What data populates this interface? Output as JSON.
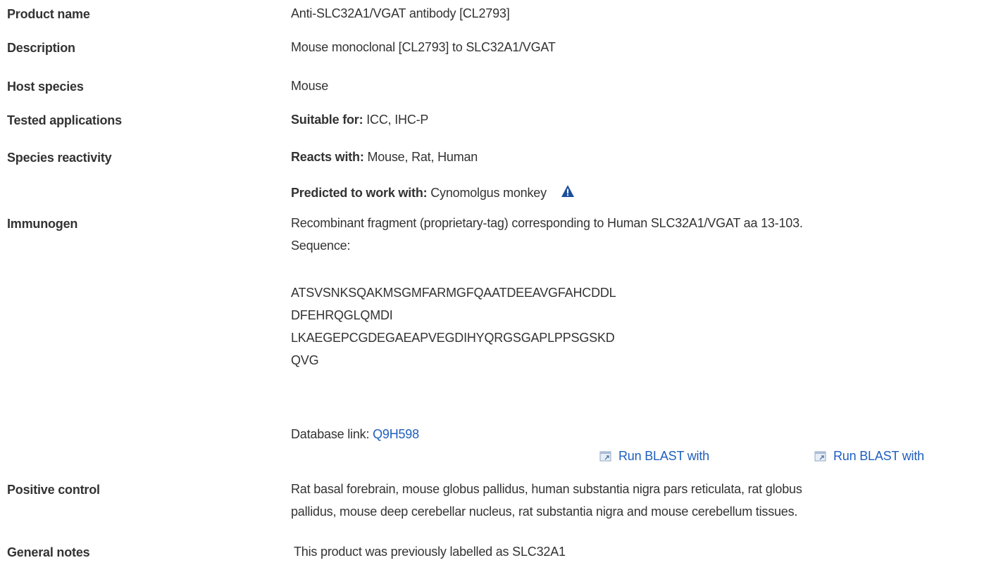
{
  "rows": {
    "product_name": {
      "label": "Product name",
      "value": "Anti-SLC32A1/VGAT antibody [CL2793]"
    },
    "description": {
      "label": "Description",
      "value": "Mouse monoclonal [CL2793] to SLC32A1/VGAT"
    },
    "host_species": {
      "label": "Host species",
      "value": "Mouse"
    },
    "tested_applications": {
      "label": "Tested applications",
      "prefix": "Suitable for:",
      "value": "ICC, IHC-P"
    },
    "species_reactivity": {
      "label": "Species reactivity",
      "reacts_prefix": "Reacts with:",
      "reacts_value": "Mouse, Rat, Human",
      "predicted_prefix": "Predicted to work with:",
      "predicted_value": "Cynomolgus monkey",
      "icon": "warning-icon"
    },
    "immunogen": {
      "label": "Immunogen",
      "line1": "Recombinant fragment (proprietary-tag) corresponding to Human SLC32A1/VGAT aa 13-103.",
      "line2": "Sequence:",
      "sequence": [
        "ATSVSNKSQAKMSGMFARMGFQAATDEEAVGFAHCDDL",
        "DFEHRQGLQMDI",
        "LKAEGEPCGDEGAEAPVEGDIHYQRGSGAPLPPSGSKD",
        "QVG"
      ],
      "database_prefix": "Database link:",
      "database_link": "Q9H598",
      "blast_1": "Run BLAST with",
      "blast_2": "Run BLAST with",
      "blast_icon": "external-window-icon"
    },
    "positive_control": {
      "label": "Positive control",
      "line1": "Rat basal forebrain, mouse globus pallidus, human substantia nigra pars reticulata, rat globus",
      "line2": "pallidus, mouse deep cerebellar nucleus, rat substantia nigra and mouse cerebellum tissues."
    },
    "general_notes": {
      "label": "General notes",
      "value": "This product was previously labelled as SLC32A1"
    }
  },
  "colors": {
    "text": "#333333",
    "link": "#1f5fbf",
    "warning_icon": "#1c4f9c"
  }
}
